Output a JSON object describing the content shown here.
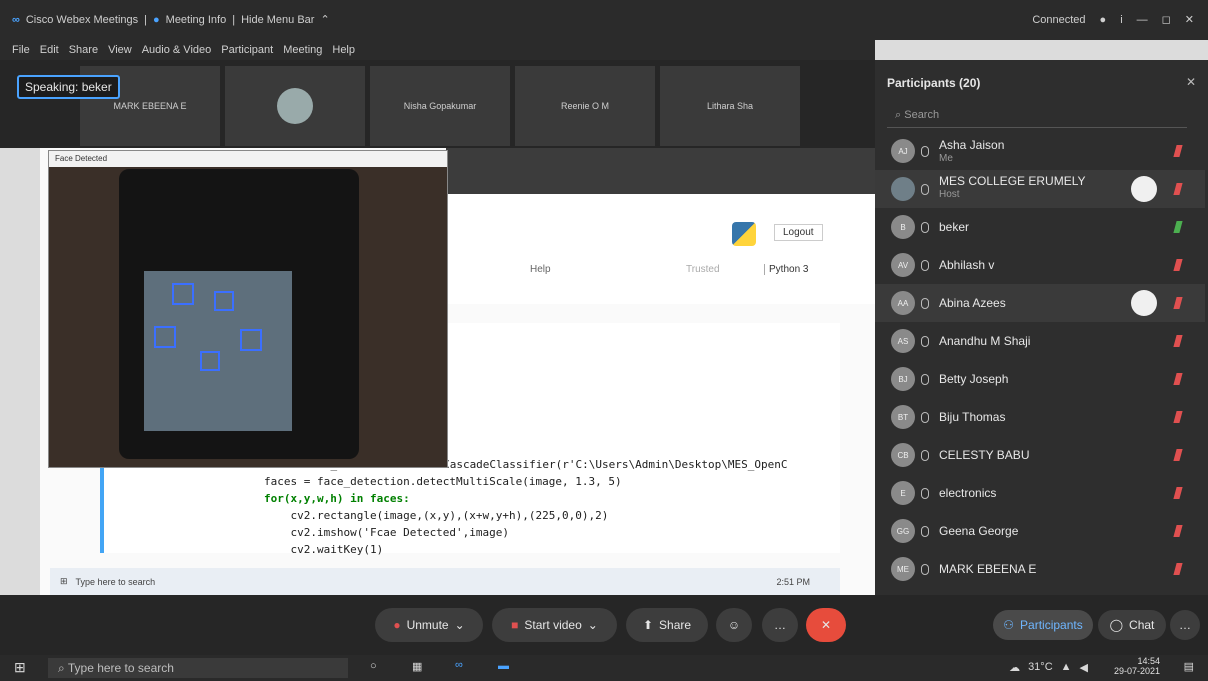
{
  "title_bar": {
    "app_name": "Cisco Webex Meetings",
    "meeting_info": "Meeting Info",
    "hide_menu": "Hide Menu Bar",
    "connection": "Connected"
  },
  "menu": [
    "File",
    "Edit",
    "Share",
    "View",
    "Audio & Video",
    "Participant",
    "Meeting",
    "Help"
  ],
  "video_strip": {
    "speaking": "Speaking: beker",
    "tiles": [
      "MARK EBEENA E",
      "",
      "Nisha Gopakumar",
      "Reenie O M",
      "Lithara Sha"
    ]
  },
  "shared_screen": {
    "face_window_title": "Face Detected",
    "jupyter": {
      "logout": "Logout",
      "help": "Help",
      "trusted": "Trusted",
      "kernel": "Python 3"
    },
    "code_lines": [
      "face_detection = cv2.CascadeClassifier(r'C:\\Users\\Admin\\Desktop\\MES_OpenC",
      "faces = face_detection.detectMultiScale(image, 1.3, 5)",
      "for(x,y,w,h) in faces:",
      "    cv2.rectangle(image,(x,y),(x+w,y+h),(225,0,0),2)",
      "    cv2.imshow('Fcae Detected',image)",
      "    cv2.waitKey(1)"
    ],
    "inner_taskbar_search": "Type here to search",
    "inner_clock": "2:51 PM"
  },
  "participants": {
    "title": "Participants (20)",
    "search_placeholder": "Search",
    "list": [
      {
        "initials": "AJ",
        "name": "Asha Jaison",
        "role": "Me",
        "active": false
      },
      {
        "initials": "",
        "name": "MES COLLEGE ERUMELY",
        "role": "Host",
        "active": false
      },
      {
        "initials": "B",
        "name": "beker",
        "role": "",
        "active": true
      },
      {
        "initials": "AV",
        "name": "Abhilash v",
        "role": "",
        "active": false
      },
      {
        "initials": "AA",
        "name": "Abina Azees",
        "role": "",
        "active": false
      },
      {
        "initials": "AS",
        "name": "Anandhu M Shaji",
        "role": "",
        "active": false
      },
      {
        "initials": "BJ",
        "name": "Betty Joseph",
        "role": "",
        "active": false
      },
      {
        "initials": "BT",
        "name": "Biju Thomas",
        "role": "",
        "active": false
      },
      {
        "initials": "CB",
        "name": "CELESTY BABU",
        "role": "",
        "active": false
      },
      {
        "initials": "E",
        "name": "electronics",
        "role": "",
        "active": false
      },
      {
        "initials": "GG",
        "name": "Geena George",
        "role": "",
        "active": false
      },
      {
        "initials": "ME",
        "name": "MARK EBEENA E",
        "role": "",
        "active": false
      }
    ]
  },
  "controls": {
    "unmute": "Unmute",
    "start_video": "Start video",
    "share": "Share",
    "participants": "Participants",
    "chat": "Chat"
  },
  "taskbar": {
    "search": "Type here to search",
    "weather": "31°C",
    "time": "14:54",
    "date": "29-07-2021"
  },
  "colors": {
    "accent": "#4aa3ff",
    "leave": "#e74c3c",
    "muted": "#e05050",
    "unmuted": "#4caf50"
  }
}
